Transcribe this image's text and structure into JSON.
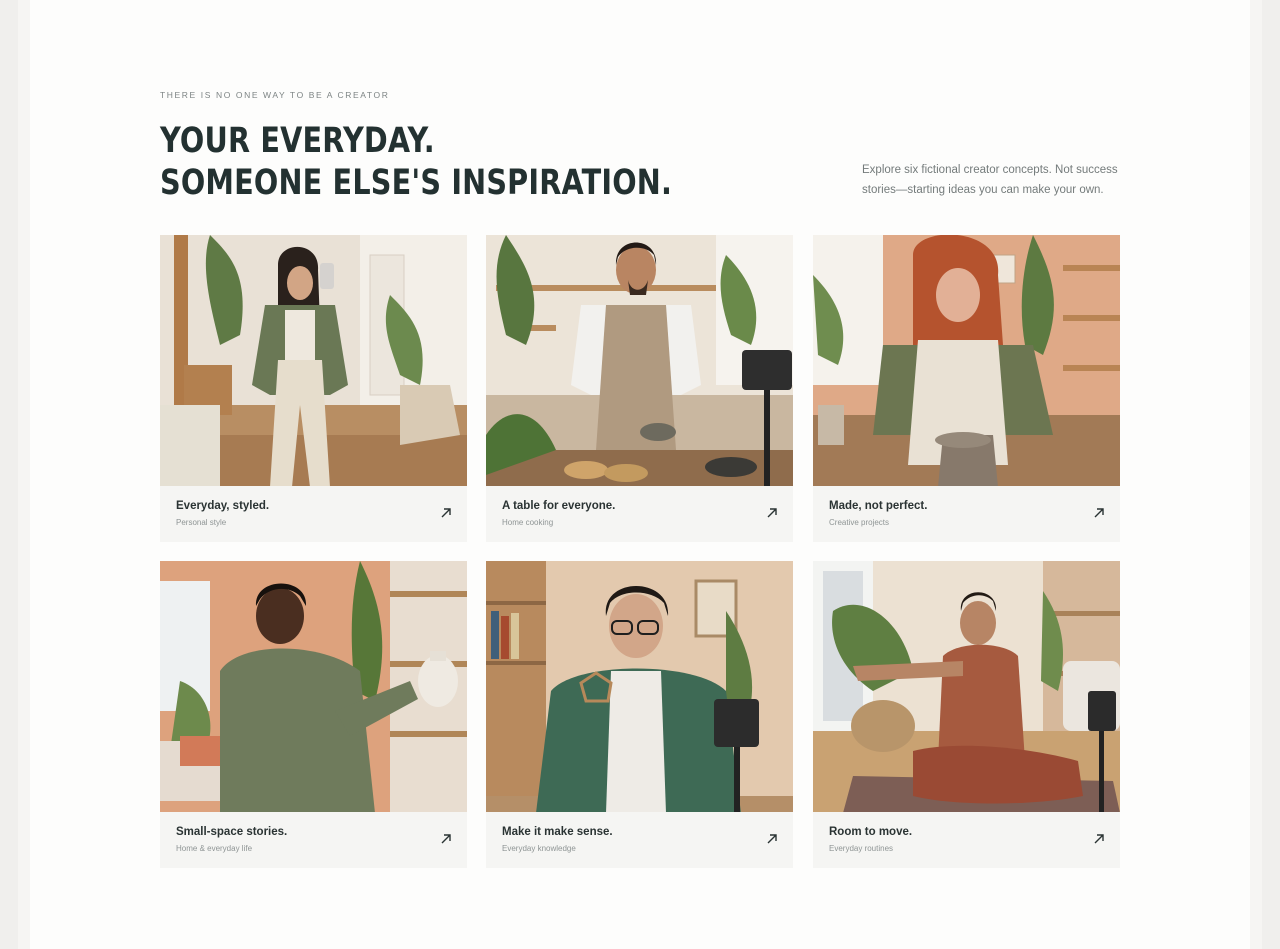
{
  "section": {
    "eyebrow": "THERE IS NO ONE WAY TO BE A CREATOR",
    "headline_line1": "YOUR EVERYDAY.",
    "headline_line2": "SOMEONE ELSE'S INSPIRATION.",
    "intro": "Explore six fictional creator concepts. Not success stories—starting ideas you can make your own."
  },
  "cards": [
    {
      "title": "Everyday, styled.",
      "subtitle": "Personal style",
      "icon": "arrow-up-right-icon",
      "photo": "woman-taking-mirror-selfie"
    },
    {
      "title": "A table for everyone.",
      "subtitle": "Home cooking",
      "icon": "arrow-up-right-icon",
      "photo": "man-cooking-tacos-with-phone-tripod"
    },
    {
      "title": "Made, not perfect.",
      "subtitle": "Creative projects",
      "icon": "arrow-up-right-icon",
      "photo": "woman-making-pottery"
    },
    {
      "title": "Small-space stories.",
      "subtitle": "Home & everyday life",
      "icon": "arrow-up-right-icon",
      "photo": "man-placing-vase-on-shelf"
    },
    {
      "title": "Make it make sense.",
      "subtitle": "Everyday knowledge",
      "icon": "arrow-up-right-icon",
      "photo": "man-explaining-geometric-model"
    },
    {
      "title": "Room to move.",
      "subtitle": "Everyday routines",
      "icon": "arrow-up-right-icon",
      "photo": "woman-stretching-on-yoga-mat"
    }
  ],
  "colors": {
    "heading": "#233131",
    "body_text": "#747b7b",
    "card_footer": "#f5f5f3",
    "page_background": "#fdfdfc"
  }
}
